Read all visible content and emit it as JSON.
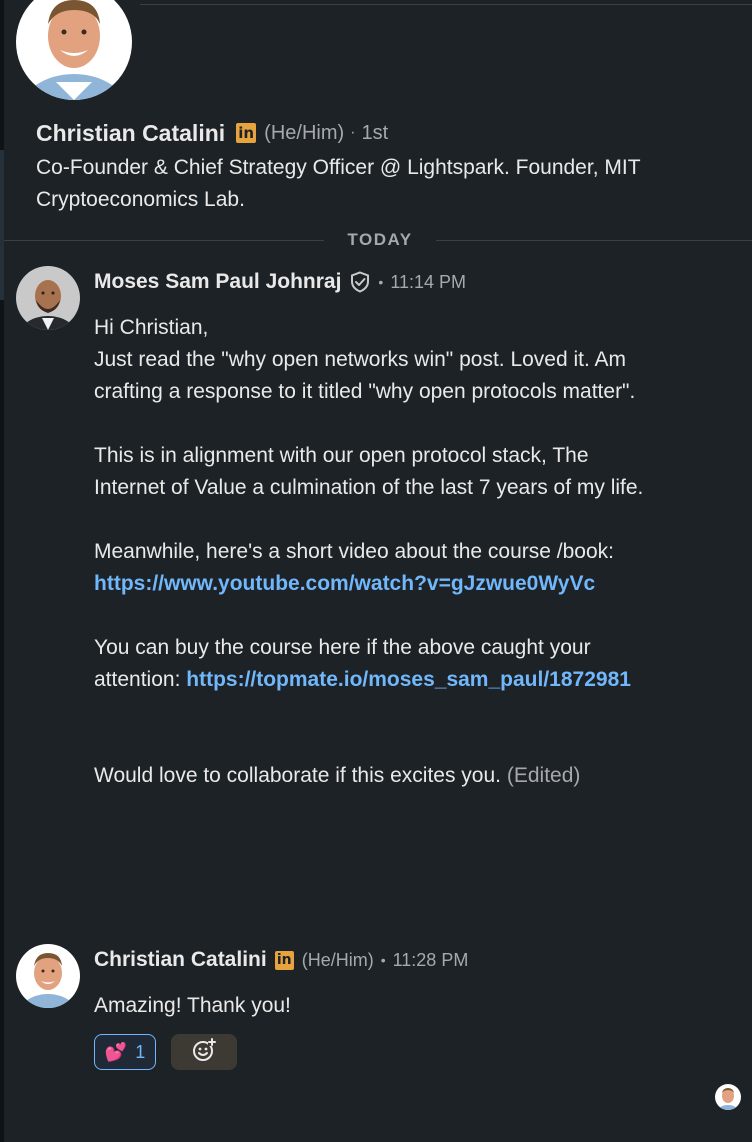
{
  "profile": {
    "name": "Christian Catalini",
    "badge": "in",
    "pronouns": "(He/Him)",
    "degree": "1st",
    "headline": "Co-Founder & Chief Strategy Officer @ Lightspark. Founder, MIT Cryptoeconomics Lab."
  },
  "divider": {
    "label": "TODAY"
  },
  "messages": [
    {
      "sender": "Moses Sam Paul Johnraj",
      "time": "11:14 PM",
      "lines": {
        "greeting": "Hi Christian,",
        "p1": "Just read the \"why open networks win\" post. Loved it. Am crafting a response to it titled \"why open protocols matter\".",
        "p2": "This is in alignment with our open protocol stack, The Internet of Value a culmination of the last 7 years of my life.",
        "p3": "Meanwhile, here's a short video about the course /book:",
        "video_link": "https://www.youtube.com/watch?v=gJzwue0WyVc",
        "p4": "You can buy the course here if the above caught your attention:",
        "course_link": "https://topmate.io/moses_sam_paul/1872981",
        "p5": "Would love to collaborate if this excites you.",
        "edited": "(Edited)"
      }
    },
    {
      "sender": "Christian Catalini",
      "badge": "in",
      "pronouns": "(He/Him)",
      "time": "11:28 PM",
      "text": "Amazing! Thank you!",
      "reaction": {
        "emoji": "💕",
        "count": "1"
      }
    }
  ],
  "icons": {
    "verified": "shield-check-icon",
    "add_reaction": "add-emoji-icon",
    "linkedin_badge": "linkedin-premium-icon"
  },
  "colors": {
    "background": "#1d2226",
    "link": "#71b7fb",
    "badge": "#e7a33e",
    "muted": "#a6a9ac"
  }
}
